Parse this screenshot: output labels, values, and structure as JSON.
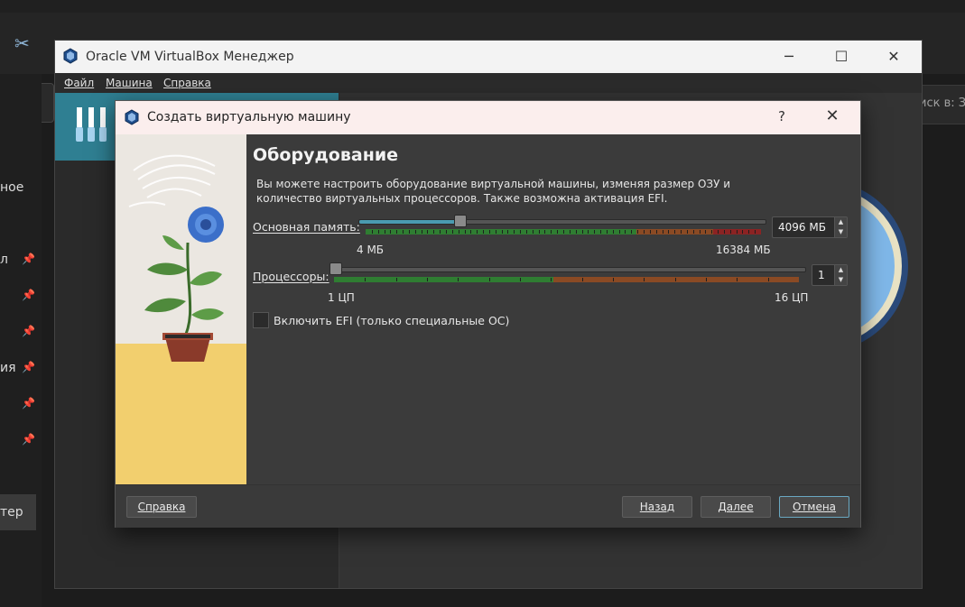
{
  "background": {
    "sidebar_texts": [
      "ное",
      "л",
      "ия",
      "тер"
    ],
    "search_text": "иск в: З",
    "pin_icon": "pin-icon"
  },
  "vb_window": {
    "title": "Oracle VM VirtualBox Менеджер",
    "menu": [
      "Файл",
      "Машина",
      "Справка"
    ]
  },
  "dialog": {
    "title": "Создать виртуальную машину",
    "help_symbol": "?",
    "close_symbol": "✕",
    "heading": "Оборудование",
    "description": "Вы можете настроить оборудование виртуальной машины, изменяя размер ОЗУ и количество виртуальных процессоров. Также возможна активация EFI.",
    "memory": {
      "label": "Основная память:",
      "value_text": "4096 МБ",
      "value": 4096,
      "min_label": "4 МБ",
      "max_label": "16384 МБ",
      "min": 4,
      "max": 16384
    },
    "cpu": {
      "label": "Процессоры:",
      "value_text": "1",
      "value": 1,
      "min_label": "1 ЦП",
      "max_label": "16 ЦП",
      "min": 1,
      "max": 16
    },
    "efi": {
      "label": "Включить EFI (только специальные ОС)",
      "checked": false
    },
    "buttons": {
      "help": "Справка",
      "back": "Назад",
      "next": "Далее",
      "cancel": "Отмена"
    }
  },
  "colors": {
    "accent": "#4a9bb0",
    "scale_green": "#2f7d32",
    "scale_orange": "#8a4a24",
    "scale_red": "#8b2323",
    "dialog_titlebar": "#fbeeed"
  }
}
